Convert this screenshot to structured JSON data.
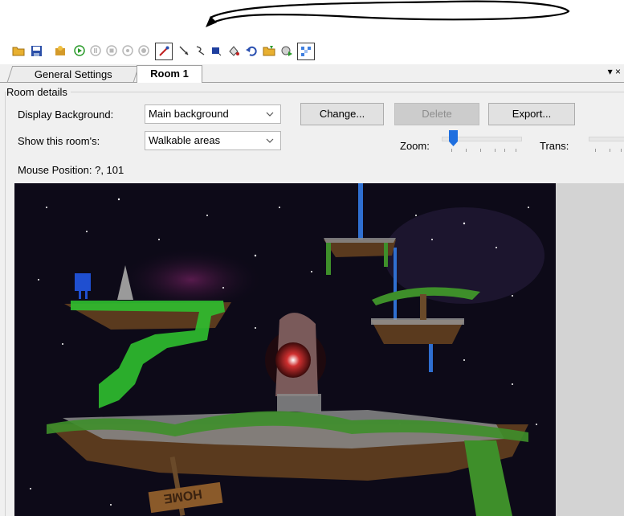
{
  "toolbar": {
    "icons": [
      "open-folder-icon",
      "save-icon",
      "compile-icon",
      "run-icon",
      "pause-icon",
      "stop-icon",
      "step-icon",
      "eyedropper-icon",
      "select-icon",
      "line-tool-icon",
      "rectangle-tool-icon",
      "fill-tool-icon",
      "undo-icon",
      "import-icon",
      "export-icon",
      "grid-icon"
    ]
  },
  "tabs": [
    {
      "label": "General Settings",
      "active": false
    },
    {
      "label": "Room 1",
      "active": true
    }
  ],
  "tab_menu": "▾ ×",
  "room_details": {
    "group_title": "Room details",
    "display_background": {
      "label": "Display Background:",
      "value": "Main background"
    },
    "show_room": {
      "label": "Show this room's:",
      "value": "Walkable areas"
    },
    "buttons": {
      "change": "Change...",
      "delete": "Delete",
      "export": "Export..."
    },
    "zoom_label": "Zoom:",
    "trans_label": "Trans:",
    "mouse_position": "Mouse Position: ?, 101"
  },
  "scene": {
    "sign_text": "HOME",
    "colors": {
      "space": "#0d0a18",
      "walkable": "#2fbf2f",
      "rock": "#5a3a1e",
      "vine": "#3e8f2a",
      "water": "#2f6fd1",
      "portal": "#c82a2a"
    }
  }
}
